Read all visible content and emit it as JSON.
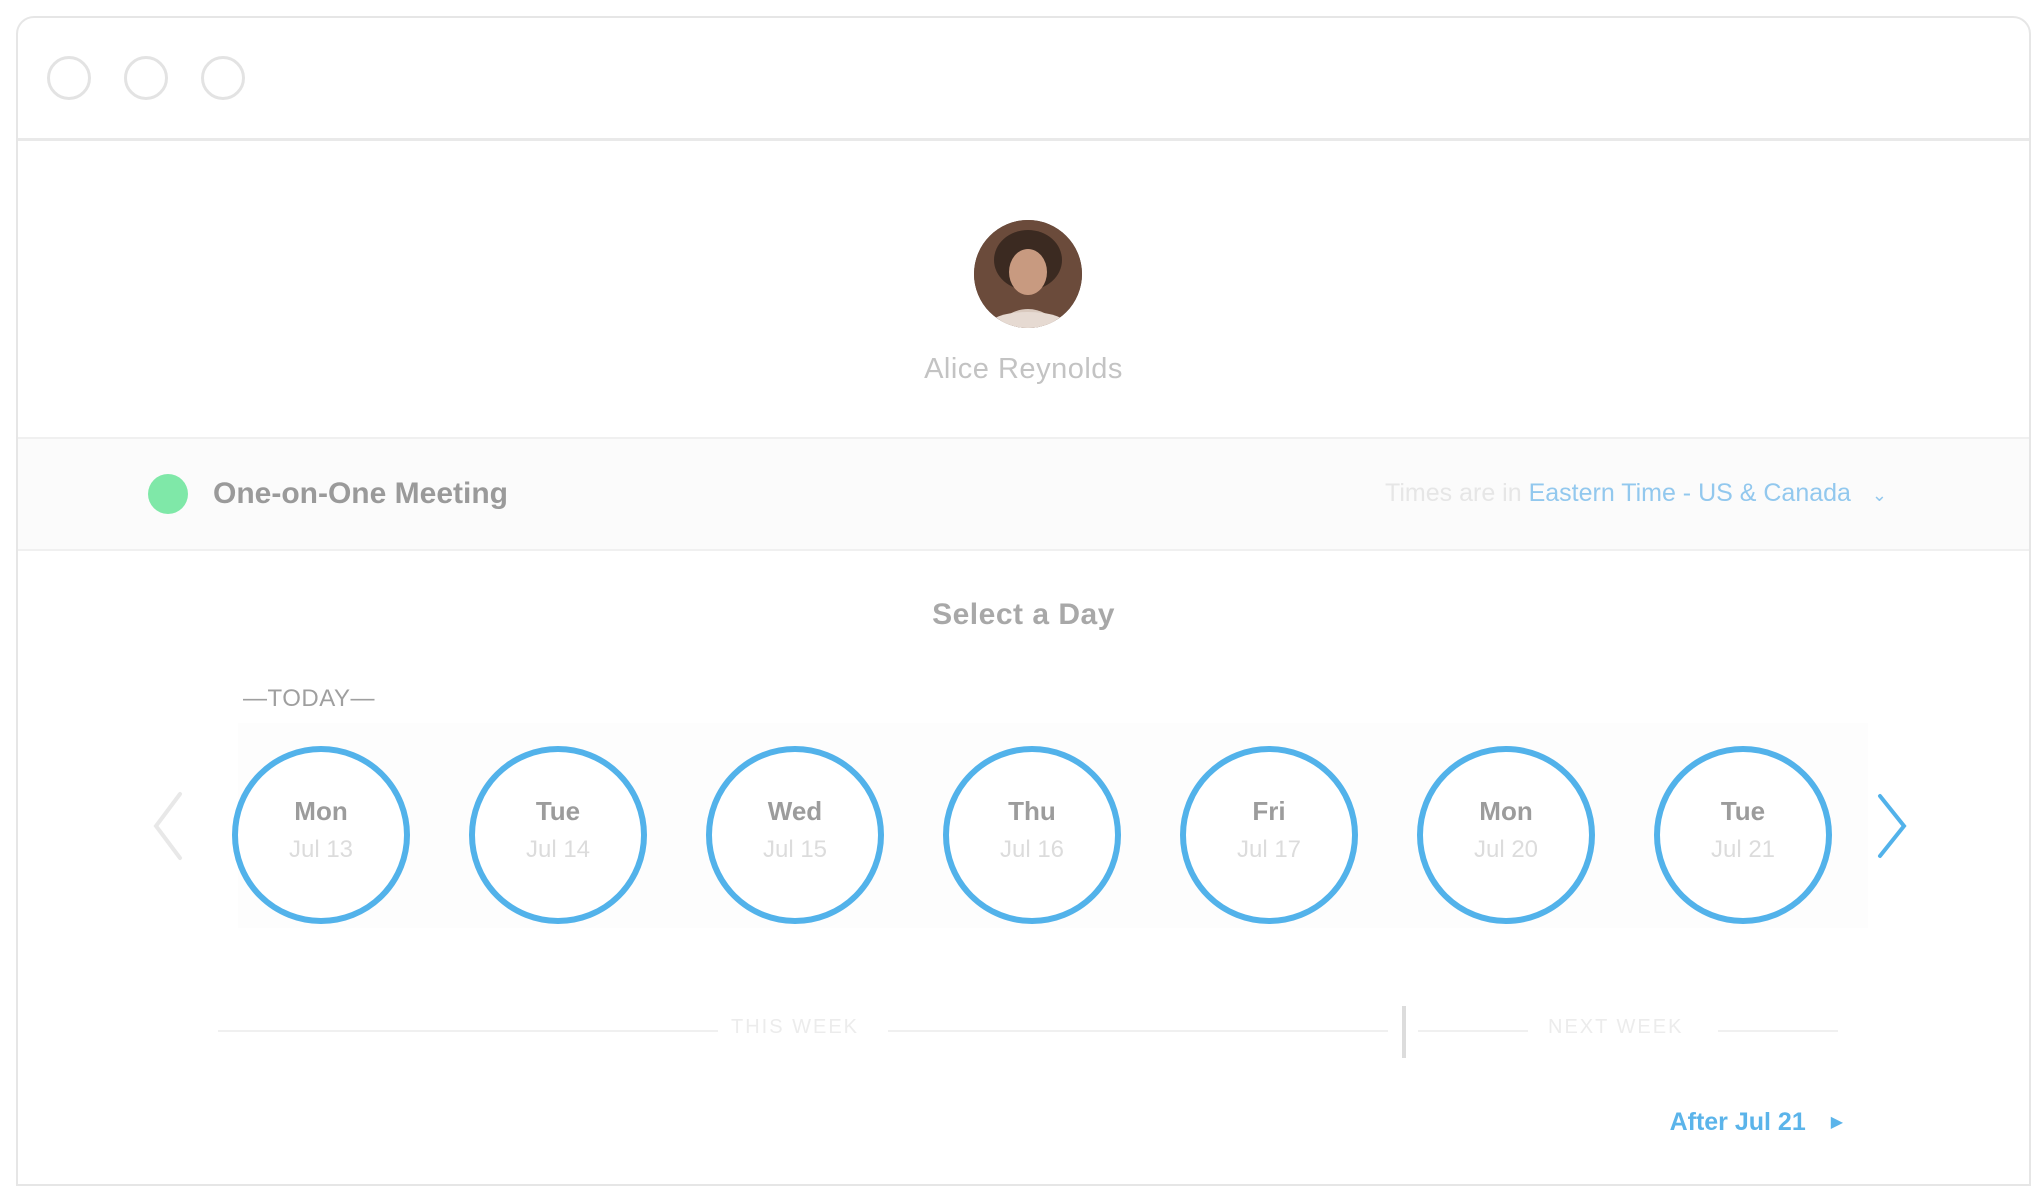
{
  "window": {
    "controls": [
      "close",
      "minimize",
      "maximize"
    ]
  },
  "profile": {
    "name": "Alice Reynolds"
  },
  "event": {
    "name": "One-on-One Meeting",
    "status_color": "#7fe8a8",
    "timezone_prefix": "Times are in",
    "timezone_value": "Eastern Time - US & Canada",
    "timezone_caret": "⌄"
  },
  "calendar": {
    "title": "Select a Day",
    "today_label": "—TODAY—",
    "prev_icon": "chevron-left-icon",
    "next_icon": "chevron-right-icon",
    "days": [
      {
        "name": "Mon",
        "date": "Jul 13"
      },
      {
        "name": "Tue",
        "date": "Jul 14"
      },
      {
        "name": "Wed",
        "date": "Jul 15"
      },
      {
        "name": "Thu",
        "date": "Jul 16"
      },
      {
        "name": "Fri",
        "date": "Jul 17"
      },
      {
        "name": "Mon",
        "date": "Jul 20"
      },
      {
        "name": "Tue",
        "date": "Jul 21"
      }
    ],
    "this_week_label": "THIS WEEK",
    "next_week_label": "NEXT WEEK",
    "after_label": "After Jul 21",
    "after_arrow": "▶"
  },
  "colors": {
    "accent": "#52b2ea",
    "link": "#5bb4ea"
  }
}
